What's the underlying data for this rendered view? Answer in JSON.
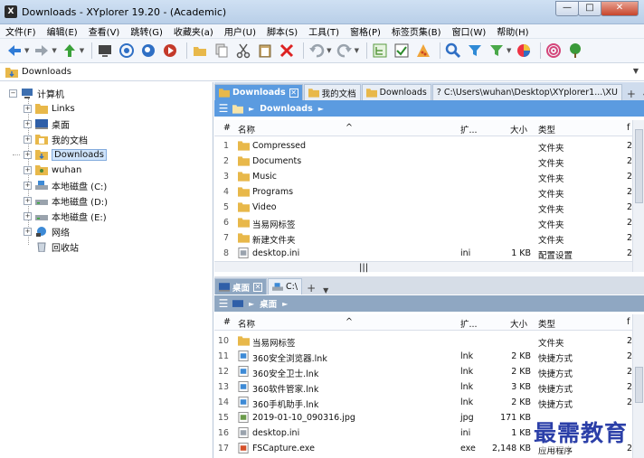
{
  "window": {
    "title": "Downloads - XYplorer 19.20 - (Academic)",
    "app_icon": "X"
  },
  "menu": [
    "文件(F)",
    "编辑(E)",
    "查看(V)",
    "跳转(G)",
    "收藏夹(a)",
    "用户(U)",
    "脚本(S)",
    "工具(T)",
    "窗格(P)",
    "标签页集(B)",
    "窗口(W)",
    "帮助(H)"
  ],
  "address": {
    "path": "Downloads"
  },
  "tree": {
    "root": "计算机",
    "items": [
      "Links",
      "桌面",
      "我的文档",
      "Downloads",
      "wuhan",
      "本地磁盘 (C:)",
      "本地磁盘 (D:)",
      "本地磁盘 (E:)",
      "网络",
      "回收站"
    ],
    "selected": "Downloads"
  },
  "pane1": {
    "tabs": [
      "Downloads",
      "我的文档",
      "Downloads",
      "C:\\Users\\wuhan\\Desktop\\XYplorer1...\\XU"
    ],
    "breadcrumb": "Downloads",
    "columns": {
      "name": "名称",
      "ext": "扩...",
      "size": "大小",
      "type": "类型",
      "extra": "f"
    },
    "rows": [
      {
        "n": "1",
        "name": "Compressed",
        "ext": "",
        "size": "",
        "type": "文件夹",
        "extra": "2"
      },
      {
        "n": "2",
        "name": "Documents",
        "ext": "",
        "size": "",
        "type": "文件夹",
        "extra": "2"
      },
      {
        "n": "3",
        "name": "Music",
        "ext": "",
        "size": "",
        "type": "文件夹",
        "extra": "2"
      },
      {
        "n": "4",
        "name": "Programs",
        "ext": "",
        "size": "",
        "type": "文件夹",
        "extra": "2"
      },
      {
        "n": "5",
        "name": "Video",
        "ext": "",
        "size": "",
        "type": "文件夹",
        "extra": "2"
      },
      {
        "n": "6",
        "name": "当易网标签",
        "ext": "",
        "size": "",
        "type": "文件夹",
        "extra": "2"
      },
      {
        "n": "7",
        "name": "新建文件夹",
        "ext": "",
        "size": "",
        "type": "文件夹",
        "extra": "2"
      },
      {
        "n": "8",
        "name": "desktop.ini",
        "ext": "ini",
        "size": "1 KB",
        "type": "配置设置",
        "extra": "2"
      }
    ]
  },
  "pane2": {
    "tabs": [
      "桌面",
      "C:\\"
    ],
    "breadcrumb": "桌面",
    "columns": {
      "name": "名称",
      "ext": "扩...",
      "size": "大小",
      "type": "类型",
      "extra": "f"
    },
    "rows": [
      {
        "n": "10",
        "name": "当易网标签",
        "ext": "",
        "size": "",
        "type": "文件夹",
        "extra": "2"
      },
      {
        "n": "11",
        "name": "360安全浏览器.lnk",
        "ext": "lnk",
        "size": "2 KB",
        "type": "快捷方式",
        "extra": "2"
      },
      {
        "n": "12",
        "name": "360安全卫士.lnk",
        "ext": "lnk",
        "size": "2 KB",
        "type": "快捷方式",
        "extra": "2"
      },
      {
        "n": "13",
        "name": "360软件管家.lnk",
        "ext": "lnk",
        "size": "3 KB",
        "type": "快捷方式",
        "extra": "2"
      },
      {
        "n": "14",
        "name": "360手机助手.lnk",
        "ext": "lnk",
        "size": "2 KB",
        "type": "快捷方式",
        "extra": "2"
      },
      {
        "n": "15",
        "name": "2019-01-10_090316.jpg",
        "ext": "jpg",
        "size": "171 KB",
        "type": "",
        "extra": ""
      },
      {
        "n": "16",
        "name": "desktop.ini",
        "ext": "ini",
        "size": "1 KB",
        "type": "",
        "extra": ""
      },
      {
        "n": "17",
        "name": "FSCapture.exe",
        "ext": "exe",
        "size": "2,148 KB",
        "type": "应用程序",
        "extra": "2"
      }
    ]
  },
  "watermark": "最需教育",
  "colors": {
    "accent": "#5b9be0",
    "folder": "#e8b84a"
  }
}
